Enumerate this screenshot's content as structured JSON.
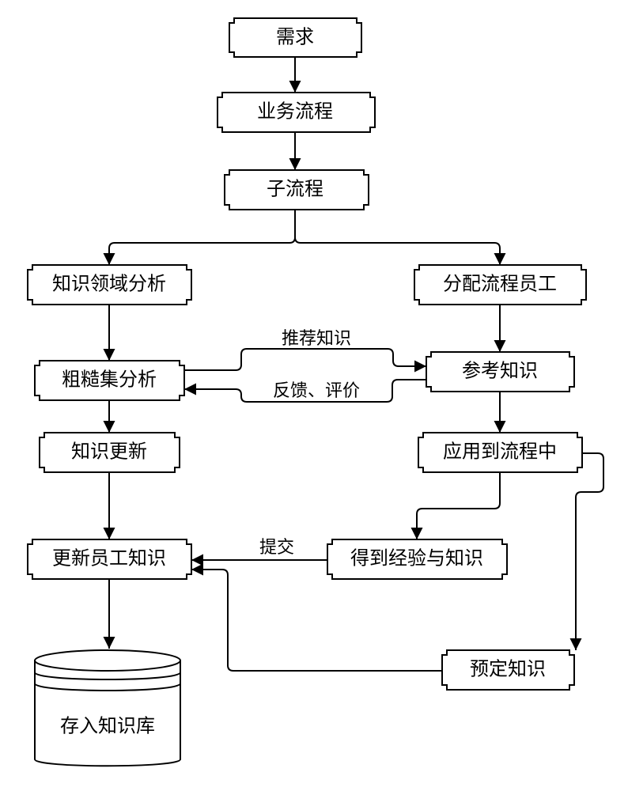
{
  "nodes": {
    "n1": "需求",
    "n2": "业务流程",
    "n3": "子流程",
    "n4": "知识领域分析",
    "n5": "分配流程员工",
    "n6": "粗糙集分析",
    "n7": "参考知识",
    "n8": "知识更新",
    "n9": "应用到流程中",
    "n10": "更新员工知识",
    "n11": "得到经验与知识",
    "n12": "预定知识",
    "n13": "存入知识库"
  },
  "edge_labels": {
    "e_rec": "推荐知识",
    "e_fb": "反馈、评价",
    "e_sub": "提交"
  },
  "chart_data": {
    "type": "flowchart",
    "nodes": [
      {
        "id": "n1",
        "label": "需求",
        "shape": "process"
      },
      {
        "id": "n2",
        "label": "业务流程",
        "shape": "process"
      },
      {
        "id": "n3",
        "label": "子流程",
        "shape": "process"
      },
      {
        "id": "n4",
        "label": "知识领域分析",
        "shape": "process"
      },
      {
        "id": "n5",
        "label": "分配流程员工",
        "shape": "process"
      },
      {
        "id": "n6",
        "label": "粗糙集分析",
        "shape": "process"
      },
      {
        "id": "n7",
        "label": "参考知识",
        "shape": "process"
      },
      {
        "id": "n8",
        "label": "知识更新",
        "shape": "process"
      },
      {
        "id": "n9",
        "label": "应用到流程中",
        "shape": "process"
      },
      {
        "id": "n10",
        "label": "更新员工知识",
        "shape": "process"
      },
      {
        "id": "n11",
        "label": "得到经验与知识",
        "shape": "process"
      },
      {
        "id": "n12",
        "label": "预定知识",
        "shape": "process"
      },
      {
        "id": "n13",
        "label": "存入知识库",
        "shape": "datastore"
      }
    ],
    "edges": [
      {
        "from": "n1",
        "to": "n2"
      },
      {
        "from": "n2",
        "to": "n3"
      },
      {
        "from": "n3",
        "to": "n4"
      },
      {
        "from": "n3",
        "to": "n5"
      },
      {
        "from": "n4",
        "to": "n6"
      },
      {
        "from": "n5",
        "to": "n7"
      },
      {
        "from": "n6",
        "to": "n7",
        "label": "推荐知识"
      },
      {
        "from": "n7",
        "to": "n6",
        "label": "反馈、评价"
      },
      {
        "from": "n6",
        "to": "n8"
      },
      {
        "from": "n7",
        "to": "n9"
      },
      {
        "from": "n8",
        "to": "n10"
      },
      {
        "from": "n9",
        "to": "n11"
      },
      {
        "from": "n9",
        "to": "n12"
      },
      {
        "from": "n11",
        "to": "n10",
        "label": "提交"
      },
      {
        "from": "n12",
        "to": "n10"
      },
      {
        "from": "n10",
        "to": "n13"
      }
    ]
  }
}
